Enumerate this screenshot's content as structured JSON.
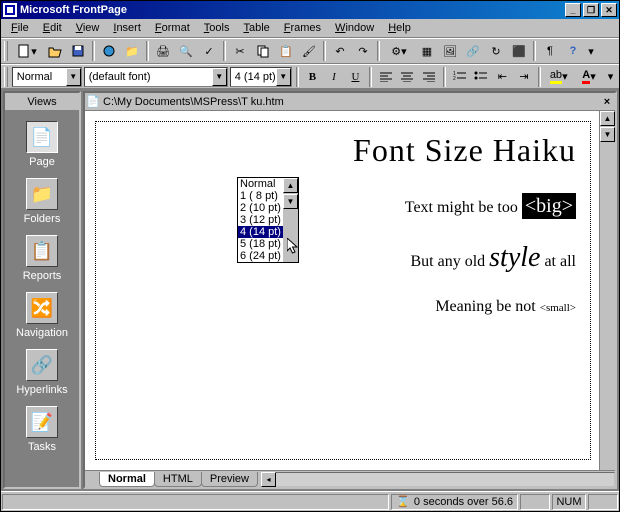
{
  "app": {
    "title": "Microsoft FrontPage"
  },
  "menu": [
    "File",
    "Edit",
    "View",
    "Insert",
    "Format",
    "Tools",
    "Table",
    "Frames",
    "Window",
    "Help"
  ],
  "format_bar": {
    "style_value": "Normal",
    "font_value": "(default font)",
    "size_value": "4 (14 pt)"
  },
  "size_dropdown": {
    "options": [
      "Normal",
      "1 (  8 pt)",
      "2 (10 pt)",
      "3 (12 pt)",
      "4 (14 pt)",
      "5 (18 pt)",
      "6 (24 pt)"
    ],
    "selected_index": 4
  },
  "views": {
    "title": "Views",
    "items": [
      {
        "label": "Page",
        "icon": "📄",
        "selected": true
      },
      {
        "label": "Folders",
        "icon": "📁",
        "selected": false
      },
      {
        "label": "Reports",
        "icon": "📋",
        "selected": false
      },
      {
        "label": "Navigation",
        "icon": "🔀",
        "selected": false
      },
      {
        "label": "Hyperlinks",
        "icon": "🔗",
        "selected": false
      },
      {
        "label": "Tasks",
        "icon": "📝",
        "selected": false
      }
    ]
  },
  "document": {
    "path": "C:\\My Documents\\MSPress\\T                             ku.htm",
    "title": "Font Size Haiku",
    "line1_a": "Text might be too ",
    "line1_b": "<big>",
    "line2_a": "But any old ",
    "line2_b": "style",
    "line2_c": " at all",
    "line3_a": "Meaning be not ",
    "line3_b": "<small>"
  },
  "doc_tabs": [
    "Normal",
    "HTML",
    "Preview"
  ],
  "status": {
    "time_text": "0 seconds over 56.6",
    "num": "NUM"
  }
}
